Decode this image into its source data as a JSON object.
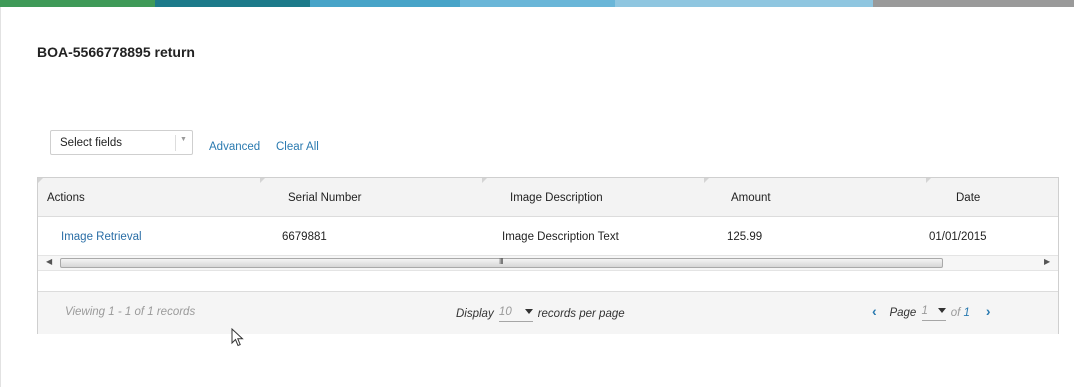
{
  "page": {
    "title": "BOA-5566778895 return"
  },
  "colors": {
    "topbar": [
      "#3f9a58",
      "#1d7a8a",
      "#48a4c8",
      "#6ab6d8",
      "#8fc6e0",
      "#9a9a9a"
    ],
    "link": "#2a7ab0"
  },
  "toolbar": {
    "select_fields": {
      "value": "Select fields",
      "icon": "dropdown-arrow-icon"
    },
    "advanced_label": "Advanced",
    "clear_all_label": "Clear All"
  },
  "grid": {
    "columns": [
      "Actions",
      "Serial Number",
      "Image Description",
      "Amount",
      "Date"
    ],
    "rows": [
      {
        "action": "Image Retrieval",
        "serial": "6679881",
        "description": "Image Description Text",
        "amount": "125.99",
        "date": "01/01/2015"
      }
    ],
    "scrollbar": {
      "left_icon": "scroll-left-arrow-icon",
      "right_icon": "scroll-right-arrow-icon",
      "grip": "III"
    }
  },
  "footer": {
    "viewing": "Viewing 1 - 1 of 1 records",
    "display_label": "Display",
    "records_per_page_value": "10",
    "records_per_page_label": "records per page",
    "page_label": "Page",
    "page_value": "1",
    "of_label": "of",
    "total_pages": "1"
  }
}
